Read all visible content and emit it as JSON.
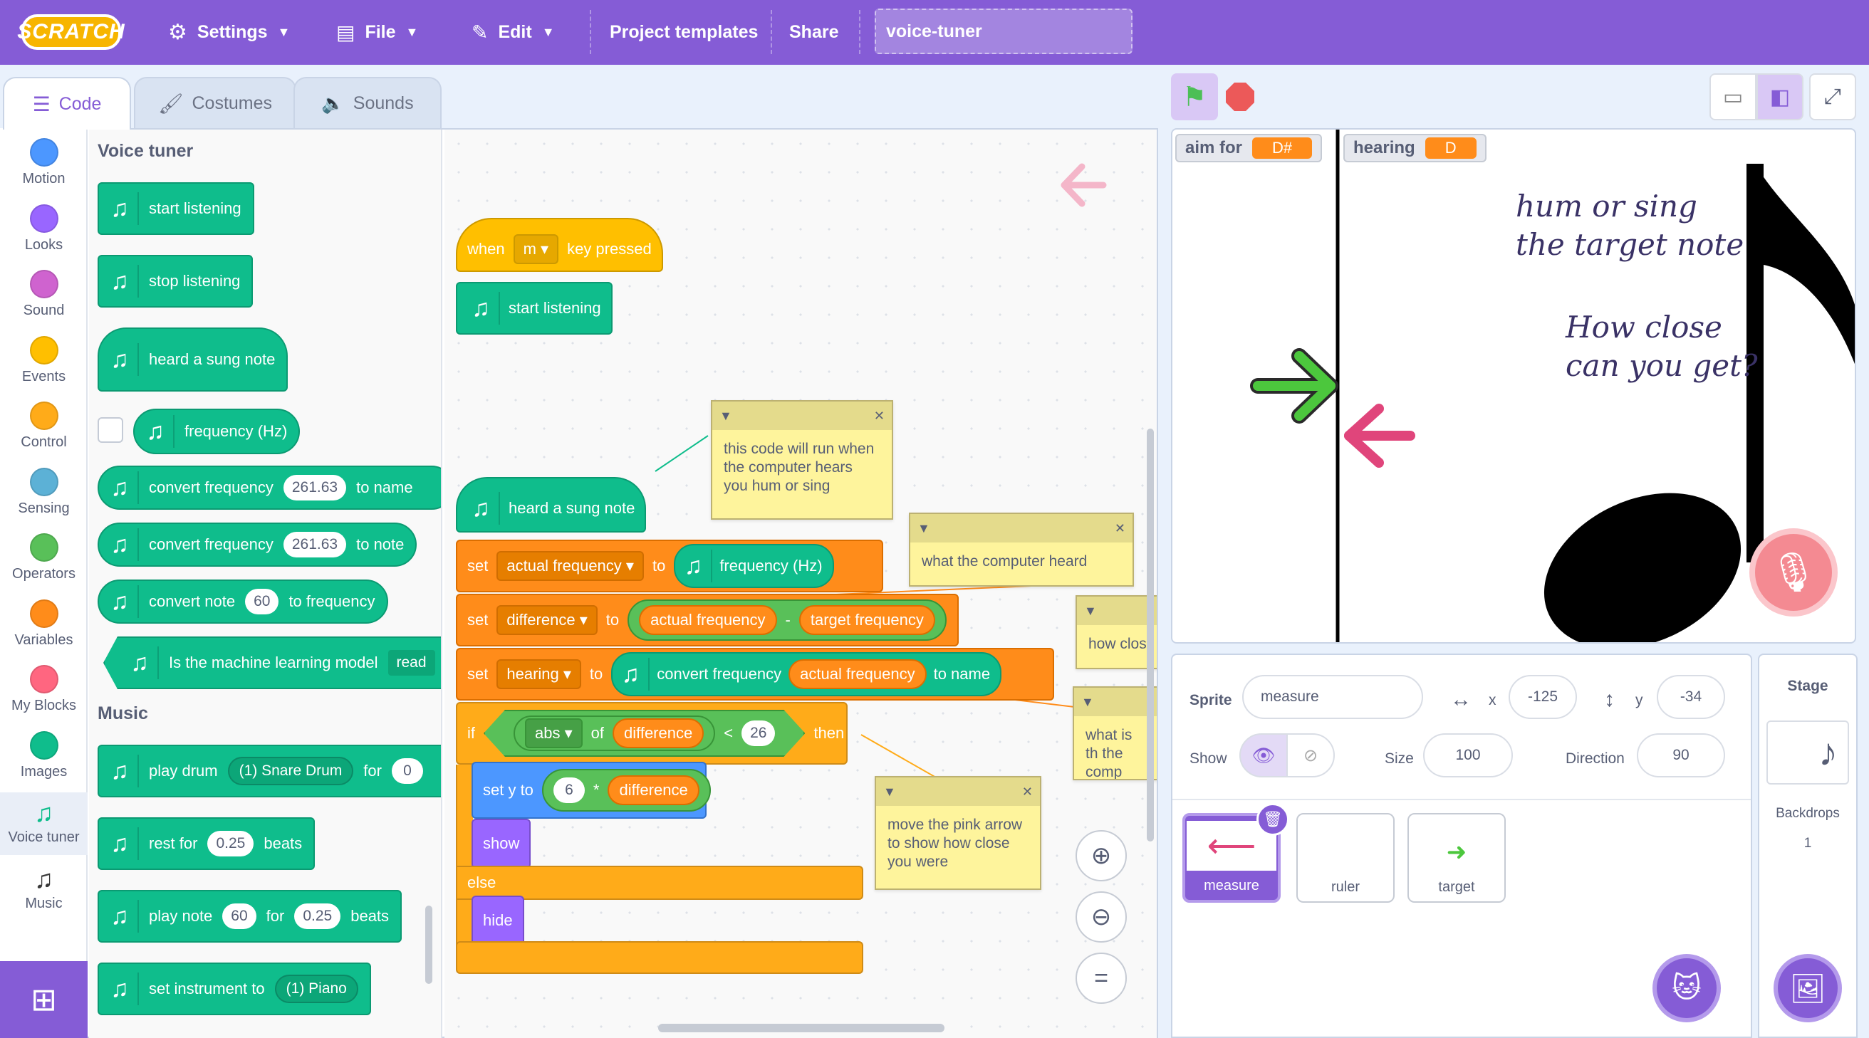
{
  "menubar": {
    "logo": "SCRATCH",
    "settings": "Settings",
    "file": "File",
    "edit": "Edit",
    "templates": "Project templates",
    "share": "Share",
    "project_title": "voice-tuner"
  },
  "tabs": {
    "code": "Code",
    "costumes": "Costumes",
    "sounds": "Sounds"
  },
  "categories": [
    {
      "label": "Motion",
      "color": "#4c97ff"
    },
    {
      "label": "Looks",
      "color": "#9966ff"
    },
    {
      "label": "Sound",
      "color": "#cf63cf"
    },
    {
      "label": "Events",
      "color": "#ffbf00"
    },
    {
      "label": "Control",
      "color": "#ffab19"
    },
    {
      "label": "Sensing",
      "color": "#5cb1d6"
    },
    {
      "label": "Operators",
      "color": "#59c059"
    },
    {
      "label": "Variables",
      "color": "#ff8c1a"
    },
    {
      "label": "My Blocks",
      "color": "#ff6680"
    },
    {
      "label": "Images",
      "color": "#0fbd8c"
    },
    {
      "label": "Voice tuner",
      "color": "#0fbd8c"
    },
    {
      "label": "Music",
      "color": "#0fbd8c"
    }
  ],
  "palette": {
    "voice_title": "Voice tuner",
    "start_listening": "start listening",
    "stop_listening": "stop listening",
    "heard_sung_note": "heard a sung note",
    "frequency_hz": "frequency (Hz)",
    "convert_frequency": "convert frequency",
    "freq_value": "261.63",
    "to_name": "to name",
    "to_note": "to note",
    "convert_note": "convert note",
    "note_value": "60",
    "to_frequency": "to frequency",
    "ml_model": "Is the machine learning model",
    "ml_ready": "read",
    "music_title": "Music",
    "play_drum": "play drum",
    "drum_value": "(1) Snare Drum",
    "for": "for",
    "drum_for_value": "0",
    "rest_for": "rest for",
    "rest_value": "0.25",
    "beats": "beats",
    "play_note": "play note",
    "play_note_value": "60",
    "play_note_beats": "0.25",
    "set_instrument": "set instrument to",
    "instrument_value": "(1) Piano"
  },
  "workspace": {
    "when": "when",
    "key_value": "m",
    "key_pressed": "key pressed",
    "start_listening": "start listening",
    "heard_sung_note": "heard a sung note",
    "set": "set",
    "to": "to",
    "var_actual": "actual frequency",
    "var_difference": "difference",
    "var_hearing": "hearing",
    "frequency_hz": "frequency (Hz)",
    "target_frequency": "target frequency",
    "minus": "-",
    "convert_frequency": "convert frequency",
    "to_name": "to name",
    "if": "if",
    "then": "then",
    "else": "else",
    "abs": "abs",
    "of": "of",
    "lt": "<",
    "threshold": "26",
    "set_y_to": "set y to",
    "mult_value": "6",
    "times": "*",
    "show": "show",
    "hide": "hide"
  },
  "comments": {
    "c1": "this code will run when the computer hears you hum or sing",
    "c2": "what the computer heard",
    "c3": "how clos",
    "c4": "what is th the comp",
    "c5": "move the pink arrow to show how close you were"
  },
  "stage": {
    "aim_label": "aim for",
    "aim_value": "D#",
    "hearing_label": "hearing",
    "hearing_value": "D",
    "line1": "hum or sing",
    "line2": "the target note",
    "line3": "How close",
    "line4": "can you get?"
  },
  "sprite_info": {
    "sprite_label": "Sprite",
    "sprite_name": "measure",
    "x_label": "x",
    "x_value": "-125",
    "y_label": "y",
    "y_value": "-34",
    "show_label": "Show",
    "size_label": "Size",
    "size_value": "100",
    "direction_label": "Direction",
    "direction_value": "90"
  },
  "sprites": [
    "measure",
    "ruler",
    "target"
  ],
  "stage_panel": {
    "title": "Stage",
    "backdrops_label": "Backdrops",
    "backdrops_count": "1"
  },
  "colors": {
    "accent": "#855cd6",
    "green_arrow": "#4cc73d",
    "pink_arrow": "#e0457b"
  }
}
